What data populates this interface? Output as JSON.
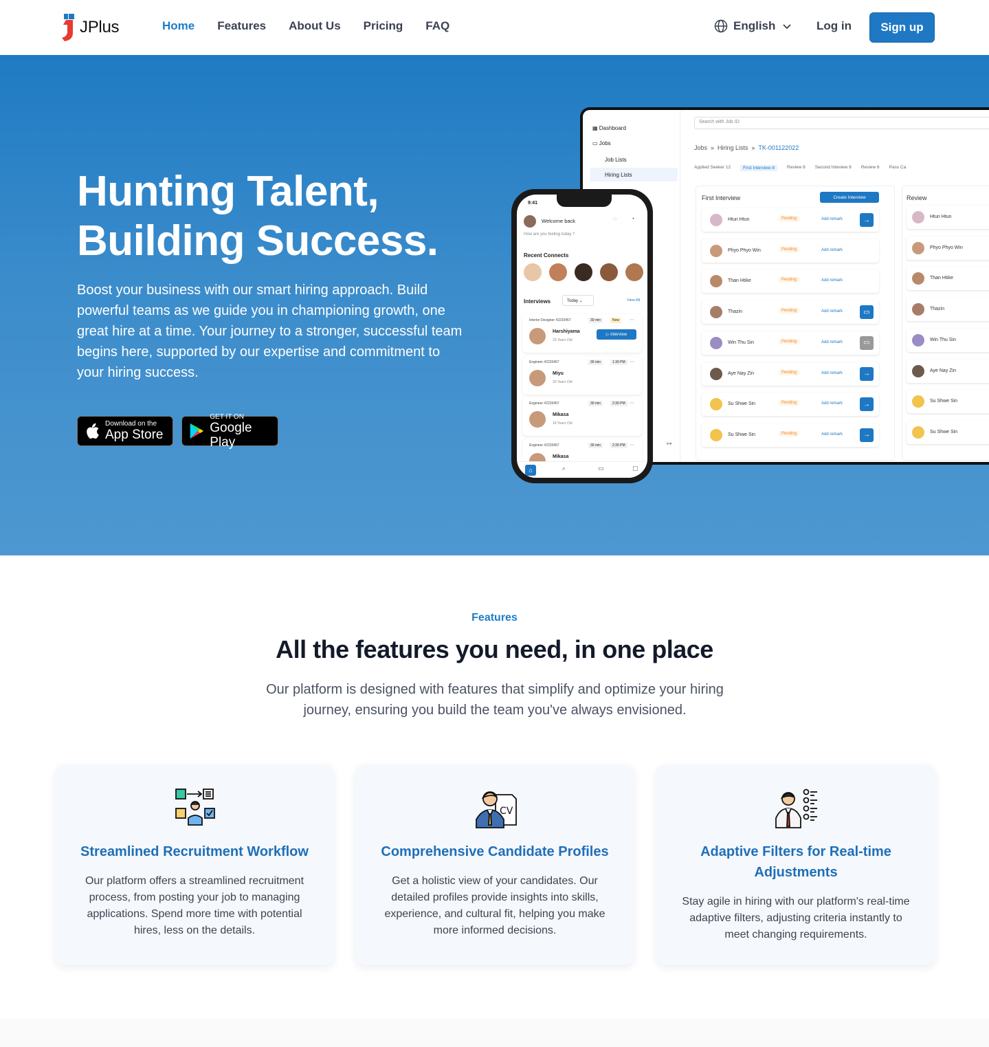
{
  "nav": {
    "logo_text": "JPlus",
    "links": [
      "Home",
      "Features",
      "About Us",
      "Pricing",
      "FAQ"
    ],
    "language": "English",
    "login": "Log in",
    "signup": "Sign up"
  },
  "hero": {
    "title_line1": "Hunting Talent,",
    "title_line2": "Building Success.",
    "body": "Boost your business with our smart hiring approach. Build powerful teams as we guide you in championing growth, one great hire at a time. Your journey to a stronger, successful team begins here, supported by our expertise and commitment to your hiring success.",
    "appstore_small": "Download on the",
    "appstore_big": "App Store",
    "gplay_small": "GET IT ON",
    "gplay_big": "Google Play"
  },
  "dashboard": {
    "search_placeholder": "Search with Job ID",
    "sidebar": [
      "Dashboard",
      "Jobs",
      "Job Lists",
      "Hiring Lists"
    ],
    "crumbs": [
      "Jobs",
      "Hiring Lists",
      "TK-001122022"
    ],
    "tabs": [
      {
        "label": "Applied Seeker",
        "count": "12"
      },
      {
        "label": "First Interview",
        "count": "8"
      },
      {
        "label": "Review",
        "count": "8"
      },
      {
        "label": "Second Inteview",
        "count": "6"
      },
      {
        "label": "Review",
        "count": "6"
      },
      {
        "label": "Pass Ca",
        "count": ""
      }
    ],
    "col1_title": "First Interview",
    "create_btn": "Create Interview",
    "col2_title": "Review",
    "status": "Pending",
    "remark": "Add remark",
    "candidates": [
      "Htun Htun",
      "Phyo Phyo Win",
      "Than Htike",
      "Thazin",
      "Win Thu Sin",
      "Aye Nay Zin",
      "Su Shwe Sin",
      "Su Shwe Sin"
    ],
    "review_candidates": [
      "Htun Htun",
      "Phyo Phyo Win",
      "Than Htike",
      "Thazin",
      "Win Thu Sin",
      "Aye Nay Zin",
      "Su Shwe Sin",
      "Su Shwe Sin"
    ]
  },
  "phone": {
    "time": "9:41",
    "welcome": "Welcome back",
    "feeling": "How are you feeling today ?",
    "recent": "Recent Connects",
    "interviews": "Interviews",
    "filter": "Today",
    "view_all": "View All",
    "cards": [
      {
        "job": "Interior Designer #2233457",
        "dur": "30 min",
        "time": "Now",
        "name": "Harshiyama",
        "age": "23 Years Old",
        "btn": "Interview"
      },
      {
        "job": "Engineer #2233457",
        "dur": "30 min",
        "time": "1:30 PM",
        "name": "Miyu",
        "age": "20 Years Old",
        "btn": ""
      },
      {
        "job": "Engineer #2233457",
        "dur": "30 min",
        "time": "2:30 PM",
        "name": "Mikasa",
        "age": "18 Years Old",
        "btn": ""
      },
      {
        "job": "Engineer #2233457",
        "dur": "30 min",
        "time": "2:30 PM",
        "name": "Mikasa",
        "age": "",
        "btn": ""
      }
    ]
  },
  "features": {
    "tag": "Features",
    "title": "All the features you need, in one place",
    "subtitle": "Our platform is designed with features that simplify and optimize your hiring journey, ensuring you build the team you've always envisioned.",
    "cards": [
      {
        "title": "Streamlined Recruitment Workflow",
        "body": "Our platform offers a streamlined recruitment process, from posting your job to managing applications. Spend more time with potential hires, less on the details.",
        "icon": "workflow-icon"
      },
      {
        "title": "Comprehensive Candidate Profiles",
        "body": "Get a holistic view of your candidates. Our detailed profiles provide insights into skills, experience, and cultural fit, helping you make more informed decisions.",
        "icon": "cv-icon"
      },
      {
        "title": "Adaptive Filters for Real-time Adjustments",
        "body": "Stay agile in hiring with our platform's real-time adaptive filters, adjusting criteria instantly to meet changing requirements.",
        "icon": "filter-checklist-icon"
      }
    ]
  },
  "colors": {
    "primary": "#1f78c4",
    "hero_top": "#1f7bc3",
    "hero_bottom": "#4e98d1",
    "pending": "#f08a24"
  }
}
